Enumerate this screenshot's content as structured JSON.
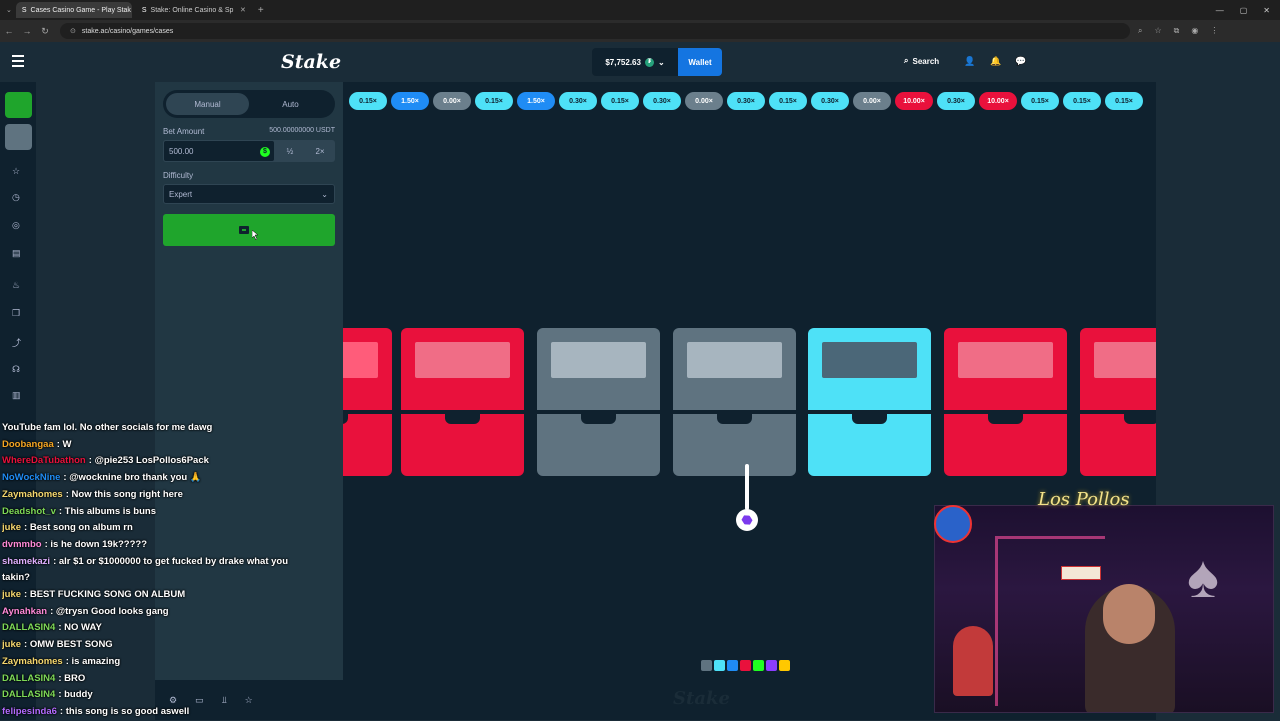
{
  "browser": {
    "tabs": [
      {
        "label": "Cases Casino Game - Play Stak",
        "active": true
      },
      {
        "label": "Stake: Online Casino & Sp",
        "active": false
      }
    ],
    "url": "stake.ac/casino/games/cases"
  },
  "header": {
    "logo": "Stake",
    "balance": "$7,752.63",
    "currency_icon": "tether-icon",
    "wallet_label": "Wallet",
    "search_label": "Search"
  },
  "panel": {
    "modes": [
      "Manual",
      "Auto"
    ],
    "active_mode": "Manual",
    "bet_label": "Bet Amount",
    "bet_balance": "500.00000000 USDT",
    "bet_value": "500.00",
    "half_label": "½",
    "double_label": "2×",
    "difficulty_label": "Difficulty",
    "difficulty_value": "Expert"
  },
  "multipliers": [
    {
      "label": "0.15×",
      "color": "#4ee1f7"
    },
    {
      "label": "1.50×",
      "color": "#1f8cf5"
    },
    {
      "label": "0.00×",
      "color": "#6b7f8c"
    },
    {
      "label": "0.15×",
      "color": "#4ee1f7"
    },
    {
      "label": "1.50×",
      "color": "#1f8cf5"
    },
    {
      "label": "0.30×",
      "color": "#4ee1f7"
    },
    {
      "label": "0.15×",
      "color": "#4ee1f7"
    },
    {
      "label": "0.30×",
      "color": "#4ee1f7"
    },
    {
      "label": "0.00×",
      "color": "#6b7f8c"
    },
    {
      "label": "0.30×",
      "color": "#4ee1f7"
    },
    {
      "label": "0.15×",
      "color": "#4ee1f7"
    },
    {
      "label": "0.30×",
      "color": "#4ee1f7"
    },
    {
      "label": "0.00×",
      "color": "#6b7f8c"
    },
    {
      "label": "10.00×",
      "color": "#e9113c"
    },
    {
      "label": "0.30×",
      "color": "#4ee1f7"
    },
    {
      "label": "10.00×",
      "color": "#e9113c"
    },
    {
      "label": "0.15×",
      "color": "#4ee1f7"
    },
    {
      "label": "0.15×",
      "color": "#4ee1f7"
    },
    {
      "label": "0.15×",
      "color": "#4ee1f7"
    }
  ],
  "colors": {
    "accent": "#1475e1",
    "bet_button": "#1fa52c",
    "red_case": "#e9113c",
    "gray_case": "#5f7380",
    "cyan_case": "#4ee1f7"
  },
  "chat": [
    {
      "user": "",
      "color": "#ffffff",
      "text": "YouTube fam lol. No other socials for me dawg"
    },
    {
      "user": "Doobangaa",
      "color": "#f5a623",
      "text": "W"
    },
    {
      "user": "WhereDaTubathon",
      "color": "#e9113c",
      "text": "@pie253 LosPollos6Pack"
    },
    {
      "user": "NoWockNine",
      "color": "#1f8cf5",
      "text": "@wocknine bro thank you 🙏"
    },
    {
      "user": "Zaymahomes",
      "color": "#f5d76e",
      "text": "Now this song right here"
    },
    {
      "user": "Deadshot_v",
      "color": "#7ed957",
      "text": "This albums is buns"
    },
    {
      "user": "juke",
      "color": "#f5d76e",
      "text": "Best song on album rn"
    },
    {
      "user": "dvmmbo",
      "color": "#ff8ad8",
      "text": "is he down 19k?????"
    },
    {
      "user": "shamekazi",
      "color": "#e0b0ff",
      "text": "alr $1 or $1000000 to get fucked by drake what you takin?"
    },
    {
      "user": "juke",
      "color": "#f5d76e",
      "text": "BEST FUCKING SONG ON ALBUM"
    },
    {
      "user": "Aynahkan",
      "color": "#ff8ad8",
      "text": "@trysn Good looks gang"
    },
    {
      "user": "DALLASIN4",
      "color": "#7ed957",
      "text": "NO WAY"
    },
    {
      "user": "juke",
      "color": "#f5d76e",
      "text": "OMW BEST SONG"
    },
    {
      "user": "Zaymahomes",
      "color": "#f5d76e",
      "text": "is amazing"
    },
    {
      "user": "DALLASIN4",
      "color": "#7ed957",
      "text": "BRO"
    },
    {
      "user": "DALLASIN4",
      "color": "#7ed957",
      "text": "buddy"
    },
    {
      "user": "felipesinda6",
      "color": "#b36bff",
      "text": "this song is so good aswell"
    }
  ],
  "webcam": {
    "signature": "Los Pollos"
  }
}
